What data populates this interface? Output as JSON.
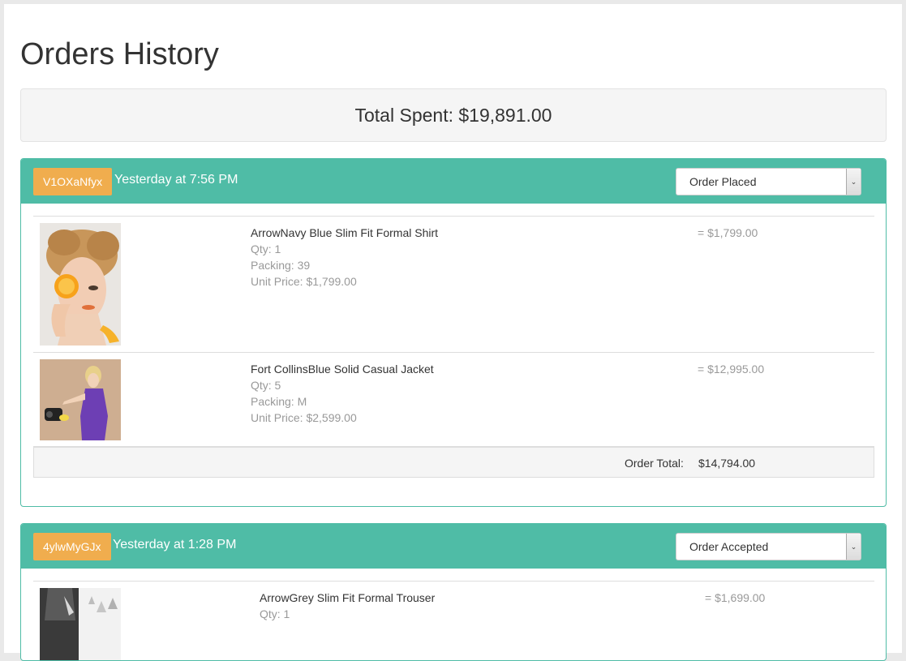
{
  "page_title": "Orders History",
  "total_spent": "Total Spent: $19,891.00",
  "orders": [
    {
      "id": "V1OXaNfyx",
      "time": "Yesterday at 7:56 PM",
      "status": "Order Placed",
      "items": [
        {
          "name": "ArrowNavy Blue Slim Fit Formal Shirt",
          "qty": "Qty: 1",
          "packing": "Packing: 39",
          "unit_price": "Unit Price: $1,799.00",
          "sum": "= $1,799.00",
          "image": "woman-with-orange-photo"
        },
        {
          "name": "Fort CollinsBlue Solid Casual Jacket",
          "qty": "Qty: 5",
          "packing": "Packing: M",
          "unit_price": "Unit Price: $2,599.00",
          "sum": "= $12,995.00",
          "image": "woman-purple-dress-photo"
        }
      ],
      "total_label": "Order Total:",
      "total_value": "$14,794.00"
    },
    {
      "id": "4ylwMyGJx",
      "time": "Yesterday at 1:28 PM",
      "status": "Order Accepted",
      "items": [
        {
          "name": "ArrowGrey Slim Fit Formal Trouser",
          "qty": "Qty: 1",
          "sum": "= $1,699.00",
          "image": "man-in-suit-photo"
        }
      ]
    }
  ],
  "colors": {
    "panel": "#4fbca6",
    "order_id_badge": "#f0ad4e"
  }
}
